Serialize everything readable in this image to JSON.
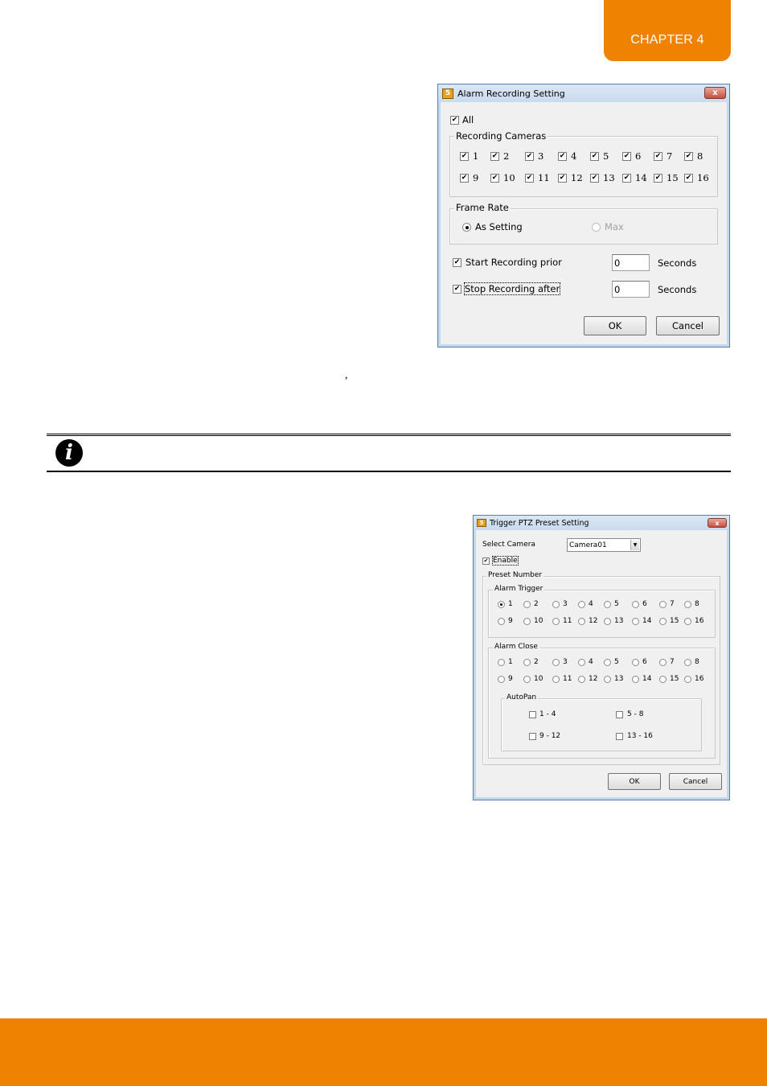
{
  "page": {
    "chapter_label": "CHAPTER 4",
    "stray_text": ",",
    "accent_color": "#ef8200",
    "note_icon": "info-icon",
    "note_icon_glyph": "i"
  },
  "alarm_recording_dialog": {
    "title": "Alarm Recording Setting",
    "title_icon": "app-icon",
    "close_glyph": "x",
    "all": {
      "label": "All",
      "checked": true
    },
    "recording_cameras": {
      "label": "Recording Cameras",
      "cameras": [
        {
          "label": "1",
          "checked": true
        },
        {
          "label": "2",
          "checked": true
        },
        {
          "label": "3",
          "checked": true
        },
        {
          "label": "4",
          "checked": true
        },
        {
          "label": "5",
          "checked": true
        },
        {
          "label": "6",
          "checked": true
        },
        {
          "label": "7",
          "checked": true
        },
        {
          "label": "8",
          "checked": true
        },
        {
          "label": "9",
          "checked": true
        },
        {
          "label": "10",
          "checked": true
        },
        {
          "label": "11",
          "checked": true
        },
        {
          "label": "12",
          "checked": true
        },
        {
          "label": "13",
          "checked": true
        },
        {
          "label": "14",
          "checked": true
        },
        {
          "label": "15",
          "checked": true
        },
        {
          "label": "16",
          "checked": true
        }
      ]
    },
    "frame_rate": {
      "label": "Frame Rate",
      "options": [
        {
          "label": "As Setting",
          "selected": true,
          "enabled": true
        },
        {
          "label": "Max",
          "selected": false,
          "enabled": false
        }
      ]
    },
    "start_recording_prior": {
      "label": "Start Recording prior",
      "checked": true,
      "value": "0",
      "unit": "Seconds"
    },
    "stop_recording_after": {
      "label": "Stop Recording after",
      "checked": true,
      "value": "0",
      "unit": "Seconds"
    },
    "ok_label": "OK",
    "cancel_label": "Cancel",
    "check_glyph": "✔"
  },
  "ptz_preset_dialog": {
    "title": "Trigger PTZ Preset Setting",
    "title_icon": "app-icon",
    "close_glyph": "x",
    "select_camera_label": "Select Camera",
    "select_camera_value": "Camera01",
    "enable": {
      "label": "Enable",
      "checked": true
    },
    "preset_number_label": "Preset Number",
    "alarm_trigger": {
      "label": "Alarm Trigger",
      "selected": "1",
      "options": [
        "1",
        "2",
        "3",
        "4",
        "5",
        "6",
        "7",
        "8",
        "9",
        "10",
        "11",
        "12",
        "13",
        "14",
        "15",
        "16"
      ]
    },
    "alarm_close": {
      "label": "Alarm Close",
      "selected": null,
      "options": [
        "1",
        "2",
        "3",
        "4",
        "5",
        "6",
        "7",
        "8",
        "9",
        "10",
        "11",
        "12",
        "13",
        "14",
        "15",
        "16"
      ]
    },
    "autopan": {
      "label": "AutoPan",
      "options": [
        {
          "label": "1 - 4",
          "checked": false
        },
        {
          "label": "5 - 8",
          "checked": false
        },
        {
          "label": "9 - 12",
          "checked": false
        },
        {
          "label": "13 - 16",
          "checked": false
        }
      ]
    },
    "ok_label": "OK",
    "cancel_label": "Cancel",
    "check_glyph": "✔",
    "dropdown_glyph": "▼"
  }
}
